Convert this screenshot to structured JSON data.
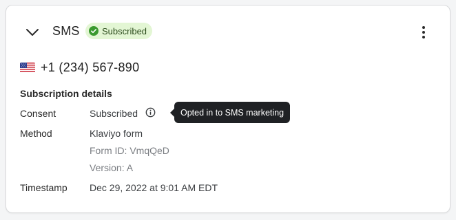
{
  "card": {
    "title": "SMS",
    "status_badge": "Subscribed",
    "status_icon": "check-circle-icon",
    "colors": {
      "badge_bg": "#e3f6d4",
      "badge_icon": "#3b9a2f",
      "tooltip_bg": "#1f2124"
    }
  },
  "phone": {
    "country_flag": "us-flag-icon",
    "number": "+1 (234) 567-890"
  },
  "details": {
    "section_title": "Subscription details",
    "consent_label": "Consent",
    "consent_value": "Subscribed",
    "method_label": "Method",
    "method_value": "Klaviyo form",
    "form_id": "Form ID: VmqQeD",
    "version": "Version: A",
    "timestamp_label": "Timestamp",
    "timestamp_value": "Dec 29, 2022 at 9:01 AM EDT"
  },
  "tooltip": {
    "text": "Opted in to SMS marketing"
  }
}
